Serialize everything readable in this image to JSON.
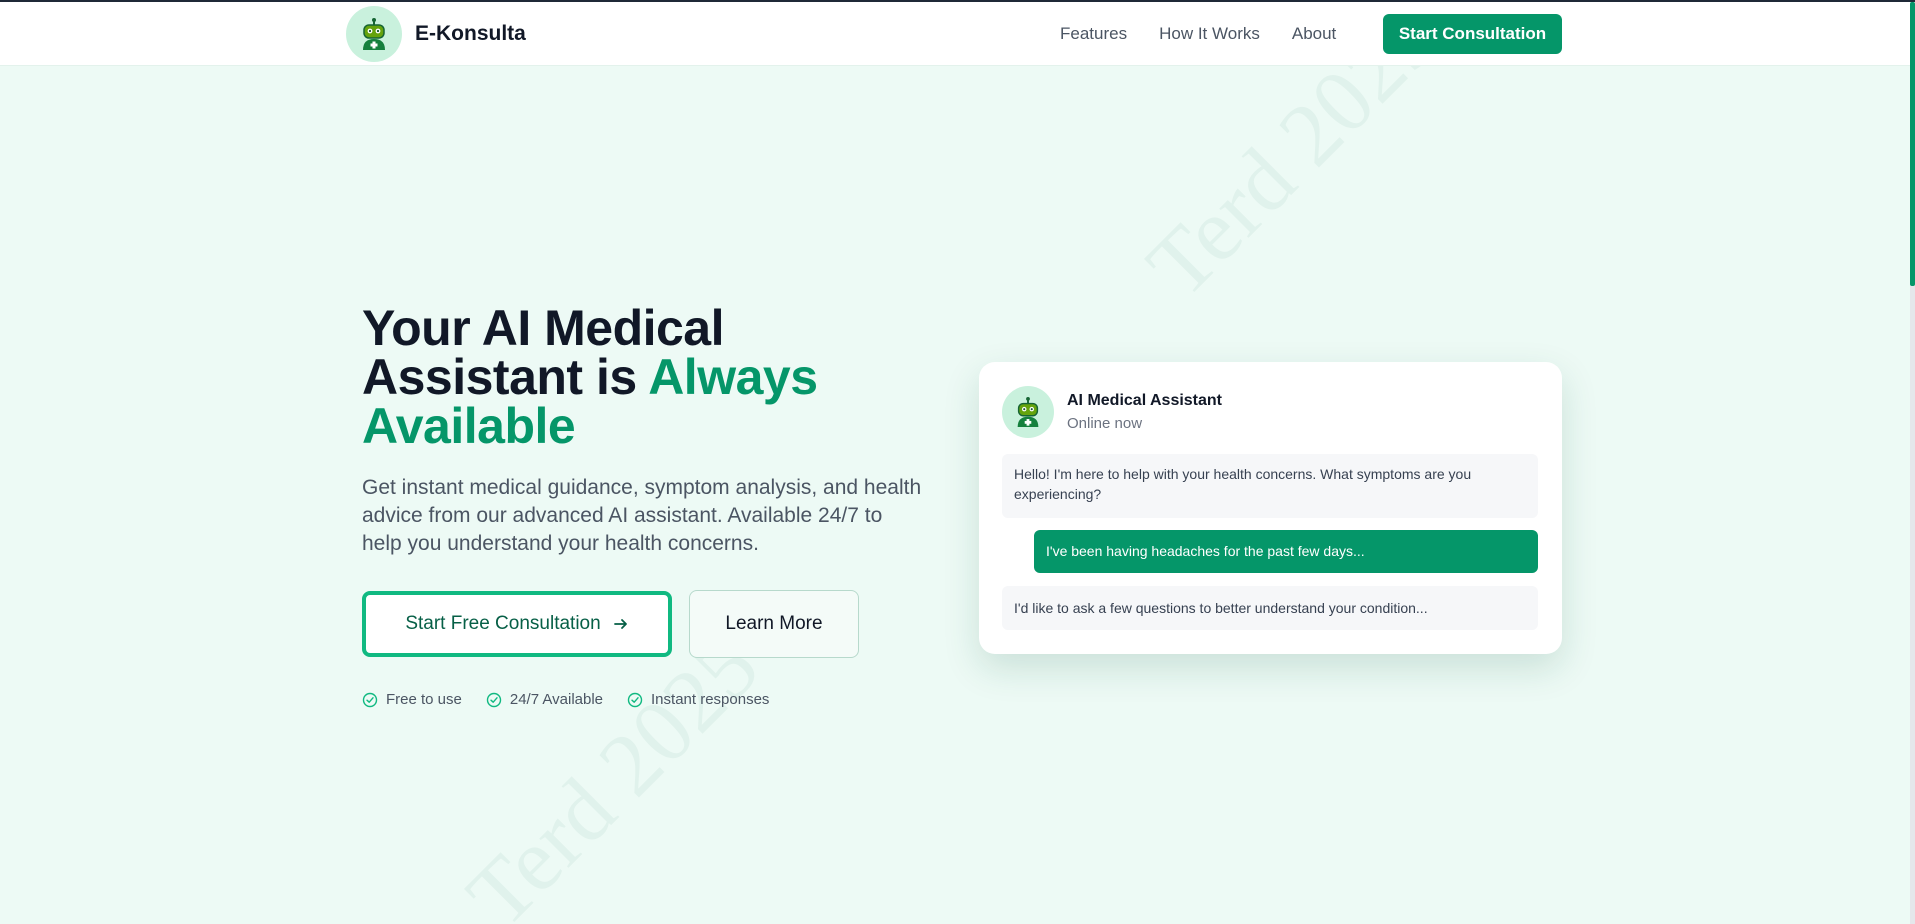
{
  "brand": {
    "name": "E-Konsulta",
    "logo_icon": "robot-medical-icon"
  },
  "nav": {
    "links": [
      "Features",
      "How It Works",
      "About"
    ],
    "cta": "Start Consultation"
  },
  "hero": {
    "title_line1": "Your AI Medical",
    "title_line2": "Assistant is ",
    "title_accent": "Always Available",
    "description": "Get instant medical guidance, symptom analysis, and health advice from our advanced AI assistant. Available 24/7 to help you understand your health concerns.",
    "primary_button": "Start Free Consultation",
    "secondary_button": "Learn More",
    "features": [
      "Free to use",
      "24/7 Available",
      "Instant responses"
    ]
  },
  "chat": {
    "assistant_name": "AI Medical Assistant",
    "status": "Online now",
    "messages": [
      "Hello! I'm here to help with your health concerns. What symptoms are you experiencing?",
      "I've been having headaches for the past few days...",
      "I'd like to ask a few questions to better understand your condition..."
    ]
  },
  "watermark": "Terd 2025",
  "colors": {
    "accent": "#059669",
    "background": "#edfaf5",
    "text": "#111827"
  }
}
